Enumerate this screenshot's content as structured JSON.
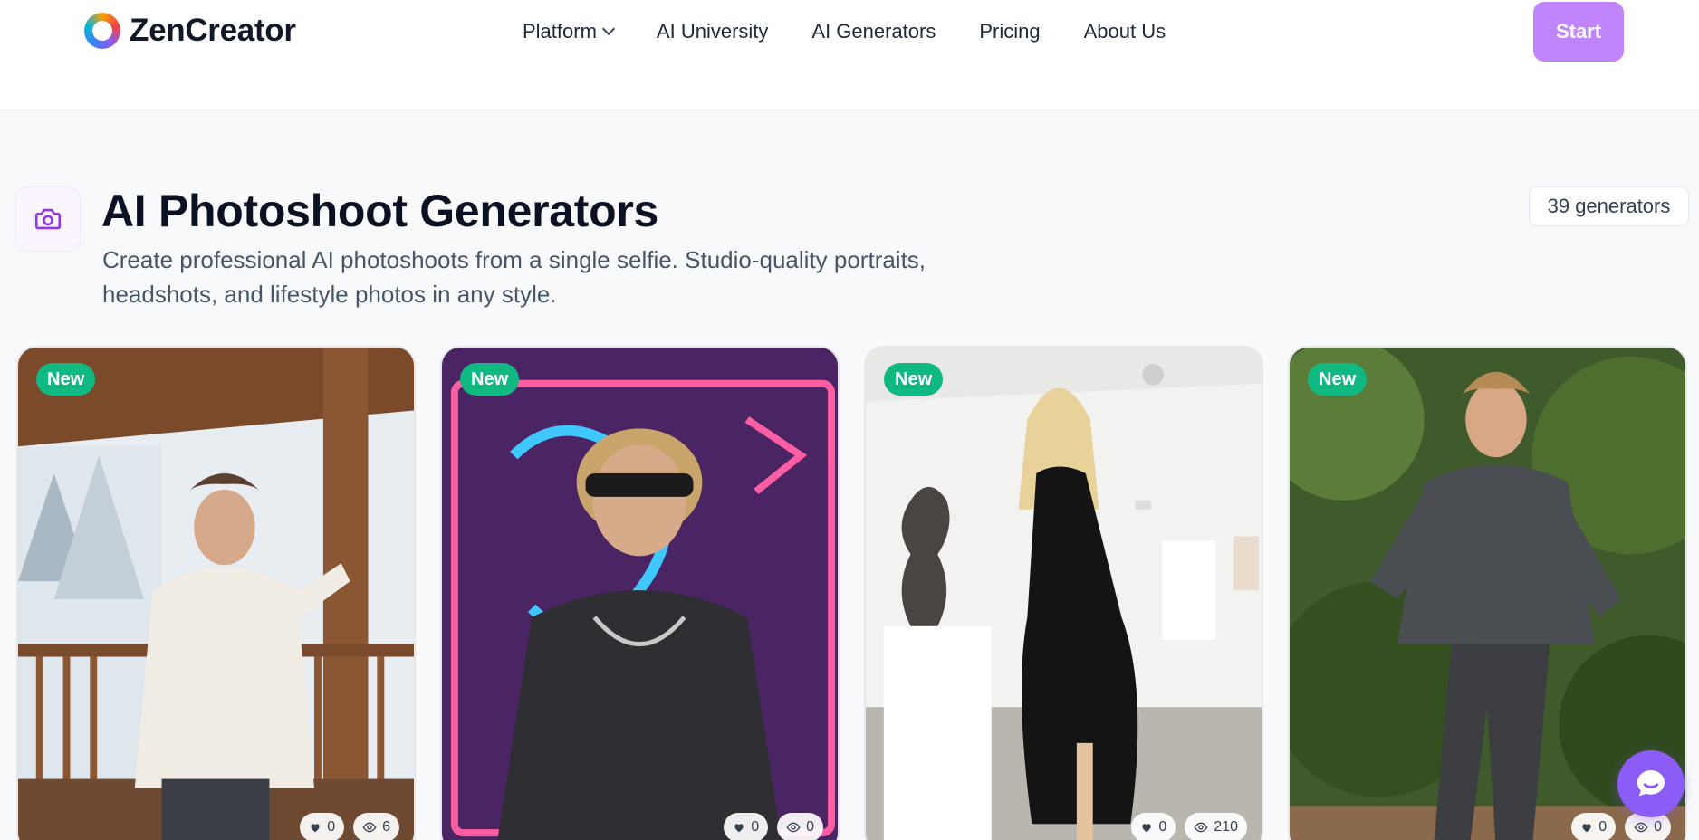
{
  "header": {
    "brand": "ZenCreator",
    "nav": [
      {
        "label": "Platform",
        "has_dropdown": true
      },
      {
        "label": "AI University"
      },
      {
        "label": "AI Generators"
      },
      {
        "label": "Pricing"
      },
      {
        "label": "About Us"
      }
    ],
    "start_label": "Start"
  },
  "category": {
    "icon": "camera-icon",
    "title": "AI Photoshoot Generators",
    "description": "Create professional AI photoshoots from a single selfie. Studio-quality portraits, headshots, and lifestyle photos in any style.",
    "count_label": "39 generators"
  },
  "cards": [
    {
      "badge": "New",
      "likes": "0",
      "views": "6"
    },
    {
      "badge": "New",
      "likes": "0",
      "views": "0"
    },
    {
      "badge": "New",
      "likes": "0",
      "views": "210"
    },
    {
      "badge": "New",
      "likes": "0",
      "views": "0"
    }
  ],
  "colors": {
    "accent": "#c084fc",
    "badge_new": "#10b981",
    "chat": "#8b5cf6"
  }
}
